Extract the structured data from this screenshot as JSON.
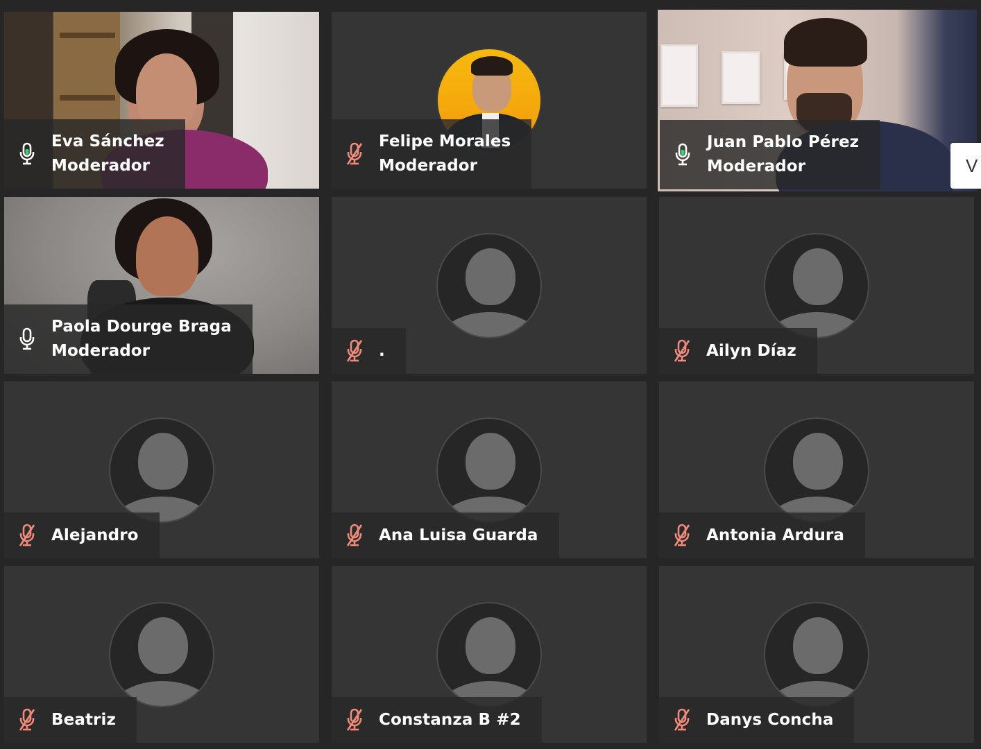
{
  "participants": [
    {
      "name": "Eva Sánchez",
      "role": "Moderador",
      "mic": "on",
      "video": "camera"
    },
    {
      "name": "Felipe Morales",
      "role": "Moderador",
      "mic": "muted",
      "video": "photo-avatar"
    },
    {
      "name": "Juan Pablo Pérez",
      "role": "Moderador",
      "mic": "on",
      "video": "camera",
      "active_speaker": true
    },
    {
      "name": "Paola Dourge Braga",
      "role": "Moderador",
      "mic": "off",
      "video": "camera"
    },
    {
      "name": ".",
      "role": "",
      "mic": "muted",
      "video": "placeholder"
    },
    {
      "name": "Ailyn Díaz",
      "role": "",
      "mic": "muted",
      "video": "placeholder"
    },
    {
      "name": "Alejandro",
      "role": "",
      "mic": "muted",
      "video": "placeholder"
    },
    {
      "name": "Ana Luisa Guarda",
      "role": "",
      "mic": "muted",
      "video": "placeholder"
    },
    {
      "name": "Antonia Ardura",
      "role": "",
      "mic": "muted",
      "video": "placeholder"
    },
    {
      "name": "Beatriz",
      "role": "",
      "mic": "muted",
      "video": "placeholder"
    },
    {
      "name": "Constanza B #2",
      "role": "",
      "mic": "muted",
      "video": "placeholder"
    },
    {
      "name": "Danys Concha",
      "role": "",
      "mic": "muted",
      "video": "placeholder"
    }
  ],
  "side_panel_peek_text": "V",
  "colors": {
    "background": "#262626",
    "tile": "#353535",
    "active_border": "#f08a7b",
    "muted_icon": "#f08a7b",
    "mic_on_icon": "#3fd06b",
    "mic_icon": "#ffffff"
  }
}
